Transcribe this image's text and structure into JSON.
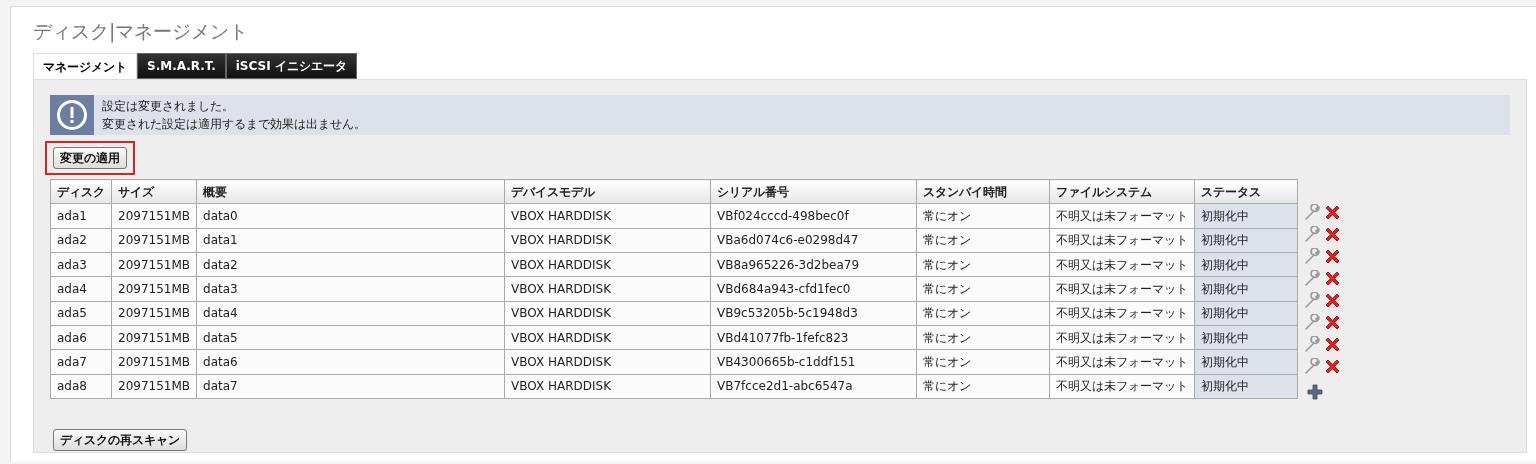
{
  "title": "ディスク|マネージメント",
  "tabs": [
    {
      "label": "マネージメント",
      "selected": true
    },
    {
      "label": "S.M.A.R.T.",
      "selected": false
    },
    {
      "label": "iSCSI イニシエータ",
      "selected": false
    }
  ],
  "notice": {
    "lines": [
      "設定は変更されました。",
      "変更された設定は適用するまで効果は出ません。"
    ]
  },
  "apply_button": {
    "label": "変更の適用",
    "highlighted": true
  },
  "table": {
    "columns": [
      "ディスク",
      "サイズ",
      "概要",
      "デバイスモデル",
      "シリアル番号",
      "スタンバイ時間",
      "ファイルシステム",
      "ステータス"
    ],
    "rows": [
      [
        "ada1",
        "2097151MB",
        "data0",
        "VBOX HARDDISK",
        "VBf024cccd-498bec0f",
        "常にオン",
        "不明又は未フォーマット",
        "初期化中"
      ],
      [
        "ada2",
        "2097151MB",
        "data1",
        "VBOX HARDDISK",
        "VBa6d074c6-e0298d47",
        "常にオン",
        "不明又は未フォーマット",
        "初期化中"
      ],
      [
        "ada3",
        "2097151MB",
        "data2",
        "VBOX HARDDISK",
        "VB8a965226-3d2bea79",
        "常にオン",
        "不明又は未フォーマット",
        "初期化中"
      ],
      [
        "ada4",
        "2097151MB",
        "data3",
        "VBOX HARDDISK",
        "VBd684a943-cfd1fec0",
        "常にオン",
        "不明又は未フォーマット",
        "初期化中"
      ],
      [
        "ada5",
        "2097151MB",
        "data4",
        "VBOX HARDDISK",
        "VB9c53205b-5c1948d3",
        "常にオン",
        "不明又は未フォーマット",
        "初期化中"
      ],
      [
        "ada6",
        "2097151MB",
        "data5",
        "VBOX HARDDISK",
        "VBd41077fb-1fefc823",
        "常にオン",
        "不明又は未フォーマット",
        "初期化中"
      ],
      [
        "ada7",
        "2097151MB",
        "data6",
        "VBOX HARDDISK",
        "VB4300665b-c1ddf151",
        "常にオン",
        "不明又は未フォーマット",
        "初期化中"
      ],
      [
        "ada8",
        "2097151MB",
        "data7",
        "VBOX HARDDISK",
        "VB7fcce2d1-abc6547a",
        "常にオン",
        "不明又は未フォーマット",
        "初期化中"
      ]
    ]
  },
  "rescan_button": {
    "label": "ディスクの再スキャン"
  }
}
